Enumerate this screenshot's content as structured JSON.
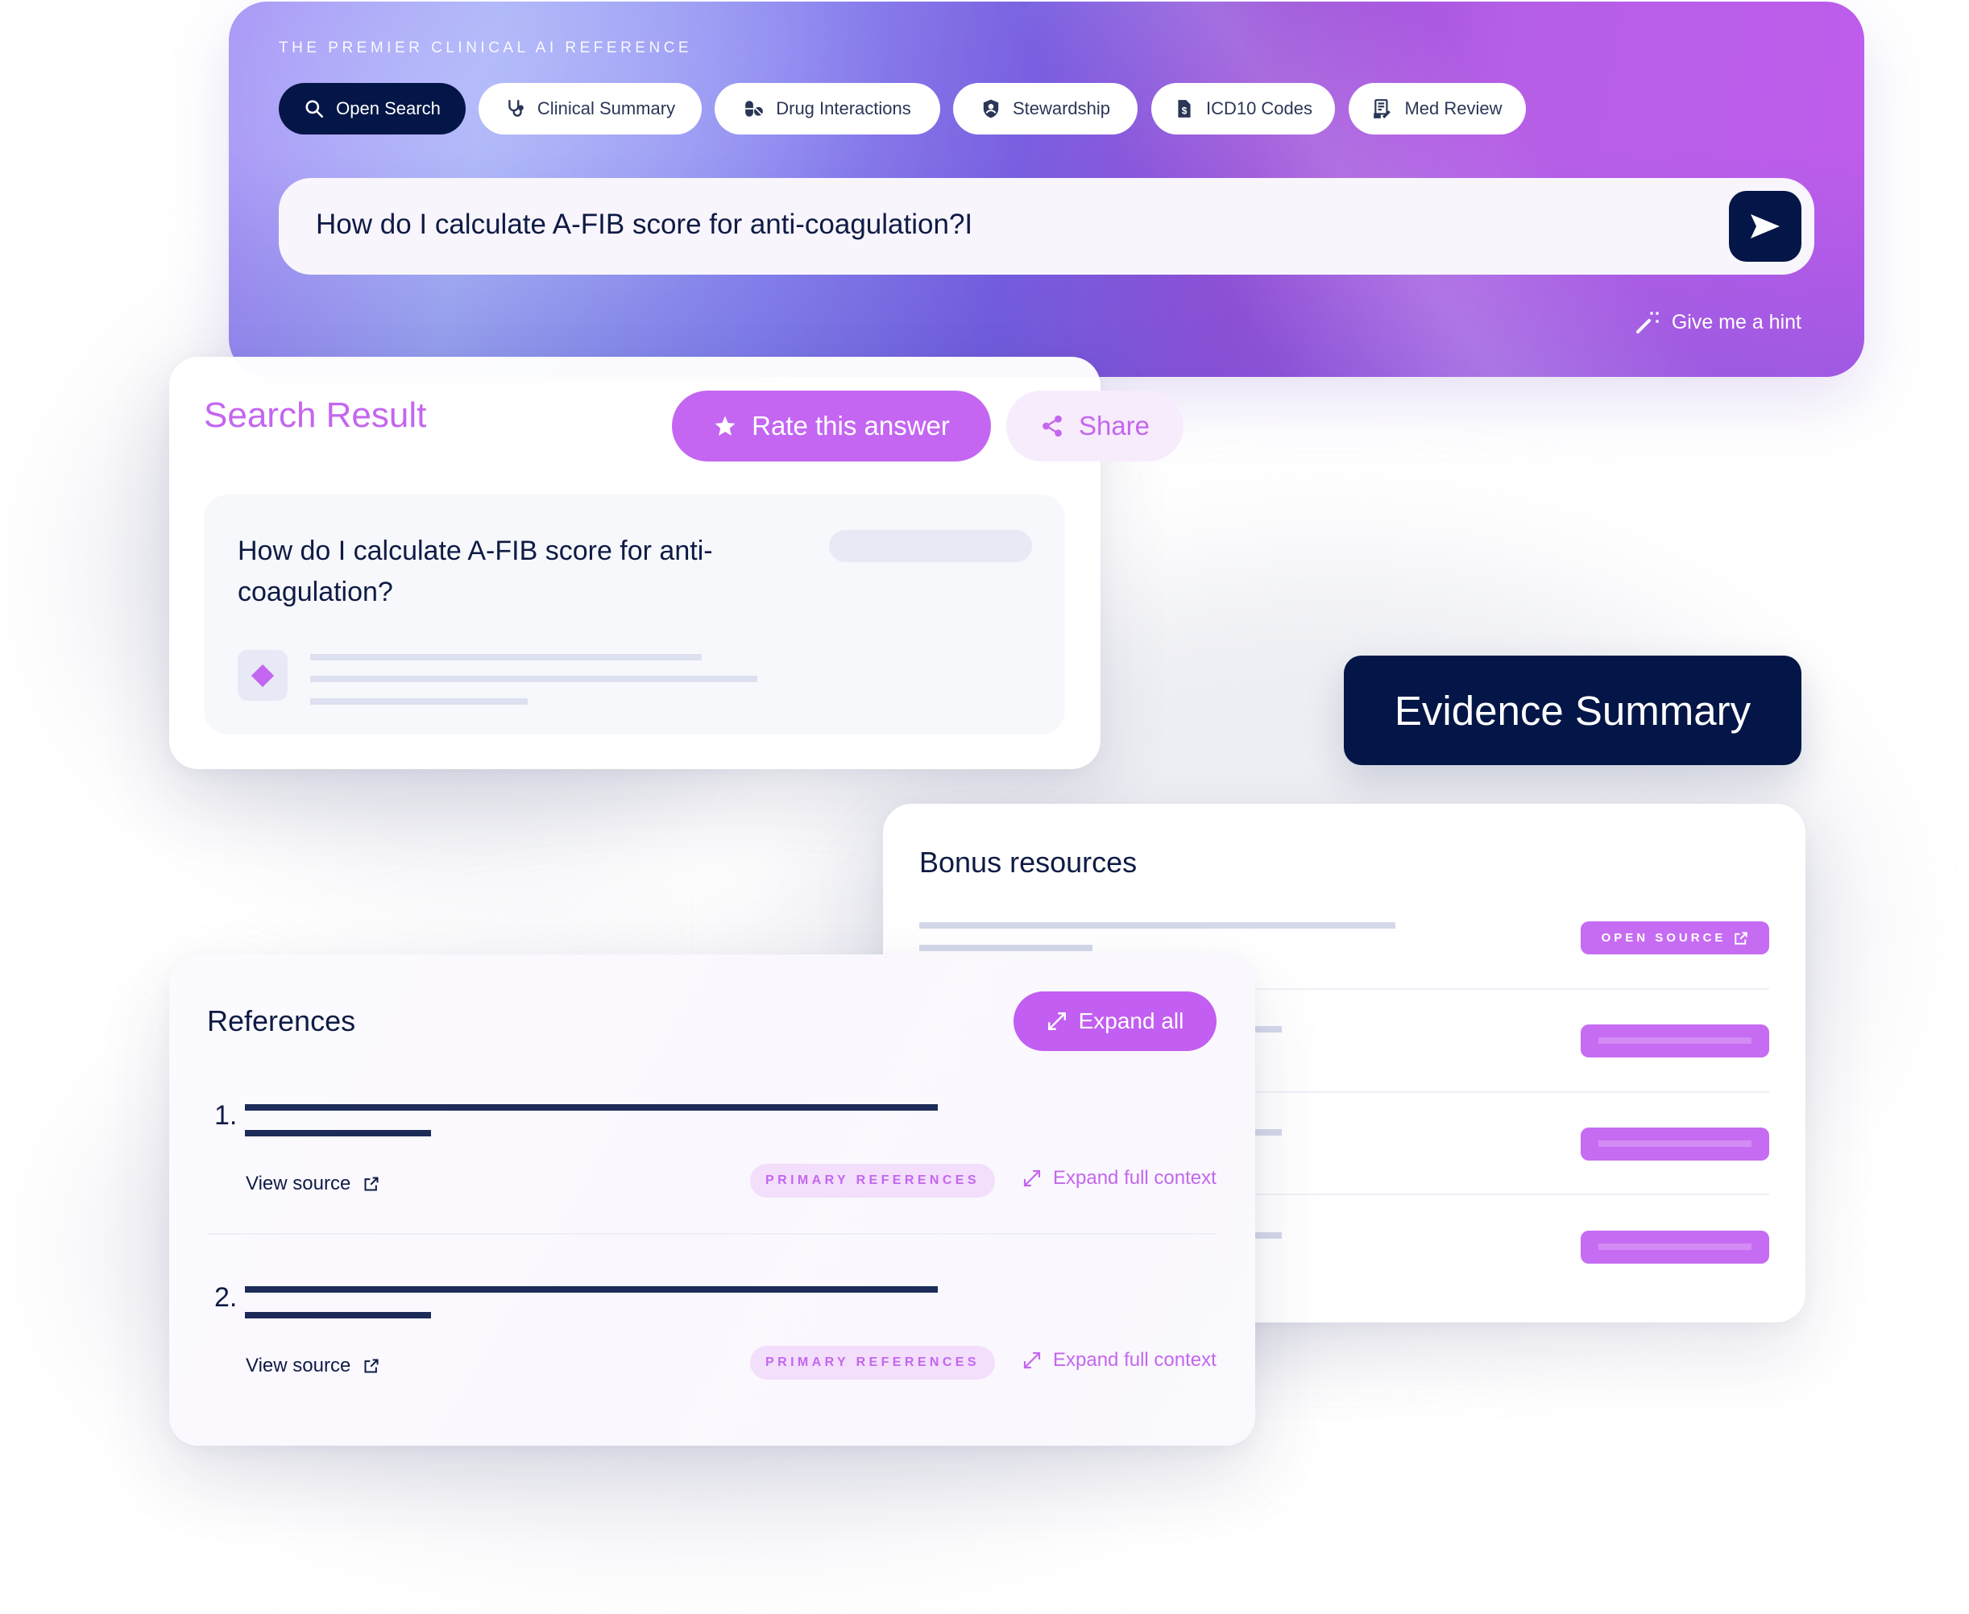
{
  "header": {
    "tagline": "THE PREMIER CLINICAL AI REFERENCE",
    "tabs": [
      {
        "label": "Open Search",
        "icon": "search-icon",
        "active": true
      },
      {
        "label": "Clinical Summary",
        "icon": "stethoscope-icon",
        "active": false
      },
      {
        "label": "Drug Interactions",
        "icon": "pills-icon",
        "active": false
      },
      {
        "label": "Stewardship",
        "icon": "shield-user-icon",
        "active": false
      },
      {
        "label": "ICD10 Codes",
        "icon": "file-dollar-icon",
        "active": false
      },
      {
        "label": "Med Review",
        "icon": "document-edit-icon",
        "active": false
      }
    ],
    "search": {
      "value": "How do I calculate A-FIB score for anti-coagulation?I",
      "send_icon": "send-icon"
    },
    "hint": {
      "label": "Give me a hint",
      "icon": "magic-wand-icon"
    }
  },
  "search_result": {
    "title": "Search Result",
    "rate_label": "Rate this answer",
    "rate_icon": "star-icon",
    "share_label": "Share",
    "share_icon": "share-icon",
    "question": "How do I calculate A-FIB score for anti-coagulation?",
    "answer_icon": "diamond-icon"
  },
  "evidence_summary": {
    "label": "Evidence Summary"
  },
  "bonus_resources": {
    "title": "Bonus resources",
    "open_source_label": "OPEN SOURCE",
    "open_source_icon": "external-link-icon"
  },
  "references": {
    "title": "References",
    "expand_all_label": "Expand all",
    "items": [
      {
        "number": "1.",
        "view_source_label": "View source",
        "badge": "PRIMARY REFERENCES",
        "expand_label": "Expand full context"
      },
      {
        "number": "2.",
        "view_source_label": "View source",
        "badge": "PRIMARY REFERENCES",
        "expand_label": "Expand full context"
      }
    ]
  },
  "colors": {
    "brand_navy": "#041647",
    "accent_purple": "#c466f1",
    "accent_light": "#f3defb"
  }
}
